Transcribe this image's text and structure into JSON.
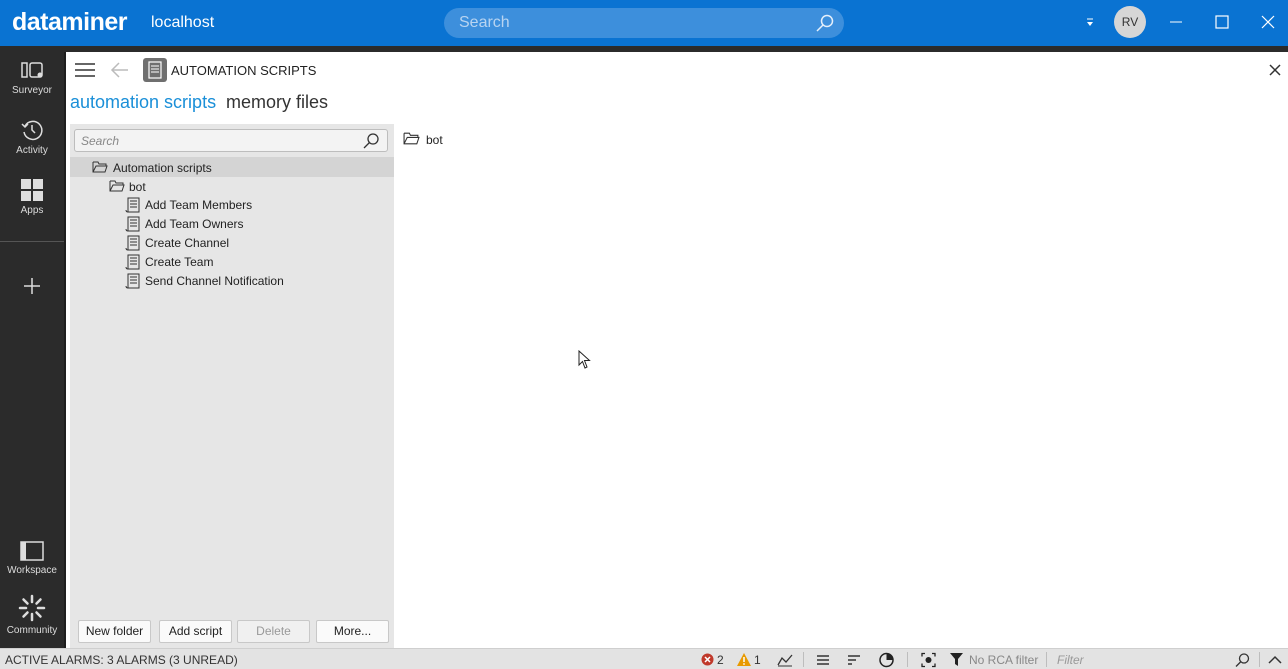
{
  "app": {
    "brand": "dataminer",
    "host": "localhost",
    "user_initials": "RV"
  },
  "topbar": {
    "search_placeholder": "Search"
  },
  "nav": [
    {
      "label": "Surveyor",
      "icon": "surveyor-icon"
    },
    {
      "label": "Activity",
      "icon": "activity-icon"
    },
    {
      "label": "Apps",
      "icon": "apps-icon"
    },
    {
      "label": "Workspace",
      "icon": "workspace-icon"
    },
    {
      "label": "Community",
      "icon": "community-icon"
    }
  ],
  "header": {
    "title": "AUTOMATION SCRIPTS"
  },
  "tabs": {
    "active": "automation scripts",
    "other": "memory files"
  },
  "left_panel": {
    "search_placeholder": "Search",
    "root": "Automation scripts",
    "folder": "bot",
    "scripts": [
      "Add Team Members",
      "Add Team Owners",
      "Create Channel",
      "Create Team",
      "Send Channel Notification"
    ],
    "buttons": {
      "new_folder": "New folder",
      "add_script": "Add script",
      "delete": "Delete",
      "more": "More..."
    }
  },
  "right_panel": {
    "folder": "bot"
  },
  "status": {
    "alarms": "ACTIVE ALARMS: 3 ALARMS (3 UNREAD)",
    "critical_count": "2",
    "warning_count": "1",
    "rca_filter": "No RCA filter",
    "filter_placeholder": "Filter"
  },
  "colors": {
    "topbar": "#0a73d2",
    "accent": "#1a8fd8",
    "nav_bg": "#2b2b2b"
  }
}
